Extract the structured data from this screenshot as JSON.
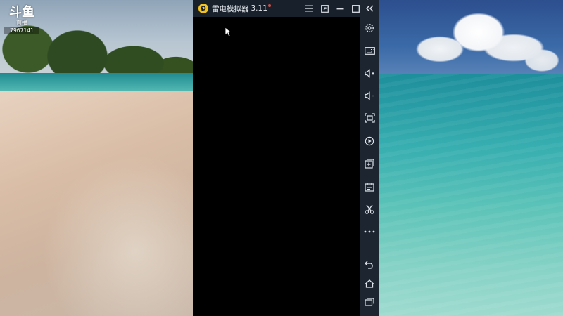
{
  "watermark": {
    "logo_text": "斗鱼",
    "sub_text": "直播",
    "room_id": "7967141"
  },
  "emulator": {
    "title": "雷电模拟器",
    "version_suffix": "3.11",
    "titlebar_buttons": [
      {
        "name": "menu",
        "icon": "hamburger-icon"
      },
      {
        "name": "fullscreen",
        "icon": "expand-icon"
      },
      {
        "name": "minimize",
        "icon": "minimize-icon"
      },
      {
        "name": "maximize",
        "icon": "maximize-icon"
      },
      {
        "name": "close",
        "icon": "close-icon"
      }
    ],
    "sidebar_tools": [
      "collapse-icon",
      "settings-icon",
      "keyboard-icon",
      "volume-up-icon",
      "volume-down-icon",
      "screenshot-icon",
      "record-icon",
      "install-apk-icon",
      "shared-folder-icon",
      "scissors-icon",
      "more-icon",
      "back-icon",
      "home-icon",
      "recent-apps-icon"
    ]
  },
  "colors": {
    "titlebar_bg": "#17202b",
    "sidebar_bg": "#1c2530",
    "logo_yellow": "#f5c21b",
    "screen_bg": "#000000"
  }
}
